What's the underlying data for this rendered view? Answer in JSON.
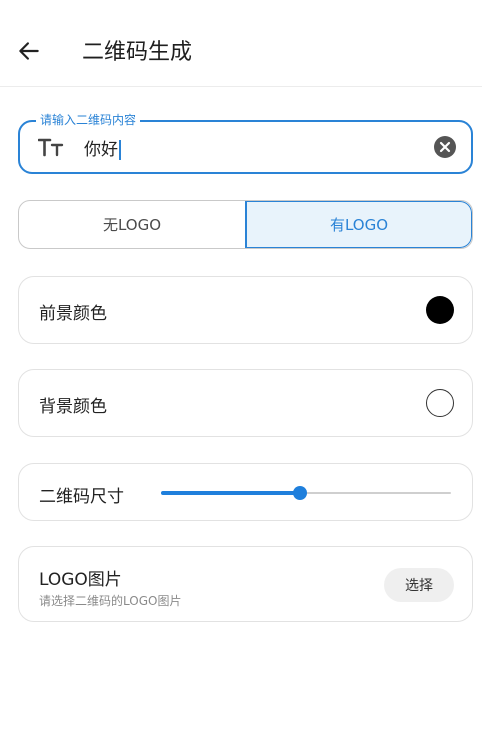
{
  "appbar": {
    "title": "二维码生成",
    "back_icon": "arrow-left-icon"
  },
  "input": {
    "label": "请输入二维码内容",
    "value": "你好",
    "accent": "#2a83d6"
  },
  "segmented": {
    "options": [
      "无LOGO",
      "有LOGO"
    ],
    "selected": "有LOGO"
  },
  "foreground": {
    "label": "前景颜色",
    "color": "#000000"
  },
  "background": {
    "label": "背景颜色",
    "color": "#ffffff"
  },
  "size": {
    "label": "二维码尺寸",
    "value_fraction": 0.48
  },
  "logo": {
    "title": "LOGO图片",
    "subtitle": "请选择二维码的LOGO图片",
    "button": "选择"
  }
}
